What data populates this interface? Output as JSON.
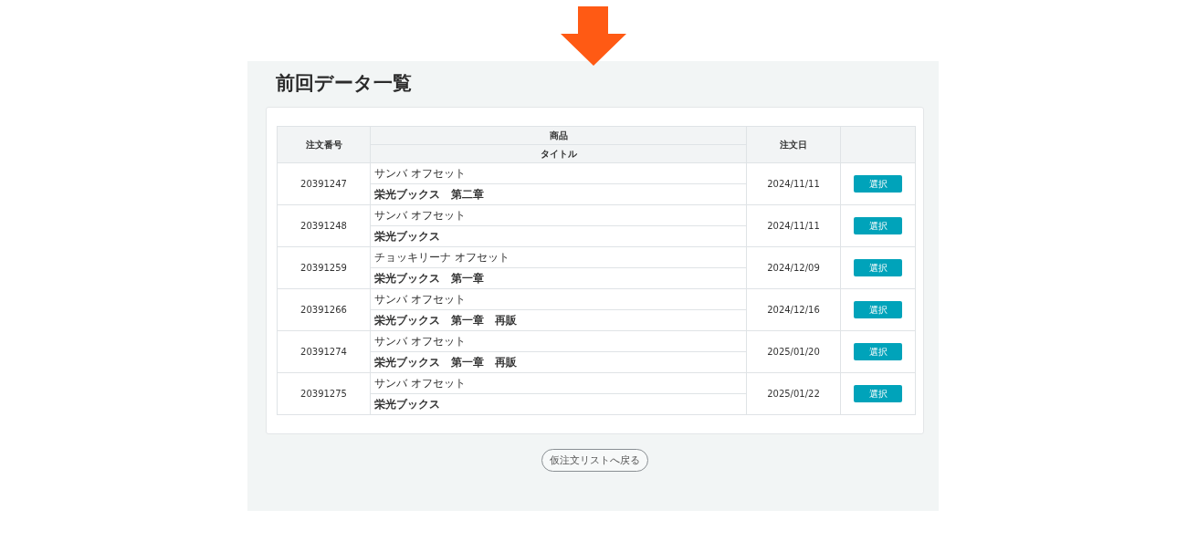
{
  "title": "前回データ一覧",
  "table": {
    "columns": [
      "注文番号",
      "商品",
      "タイトル",
      "注文日"
    ],
    "rows": [
      {
        "order_no": "20391247",
        "product": "サンバ オフセット",
        "title": "栄光ブックス　第二章",
        "date": "2024/11/11",
        "action": "選択"
      },
      {
        "order_no": "20391248",
        "product": "サンバ オフセット",
        "title": "栄光ブックス",
        "date": "2024/11/11",
        "action": "選択"
      },
      {
        "order_no": "20391259",
        "product": "チョッキリーナ オフセット",
        "title": "栄光ブックス　第一章",
        "date": "2024/12/09",
        "action": "選択"
      },
      {
        "order_no": "20391266",
        "product": "サンバ オフセット",
        "title": "栄光ブックス　第一章　再販",
        "date": "2024/12/16",
        "action": "選択"
      },
      {
        "order_no": "20391274",
        "product": "サンバ オフセット",
        "title": "栄光ブックス　第一章　再販",
        "date": "2025/01/20",
        "action": "選択"
      },
      {
        "order_no": "20391275",
        "product": "サンバ オフセット",
        "title": "栄光ブックス",
        "date": "2025/01/22",
        "action": "選択"
      }
    ]
  },
  "back_button": "仮注文リストへ戻る"
}
